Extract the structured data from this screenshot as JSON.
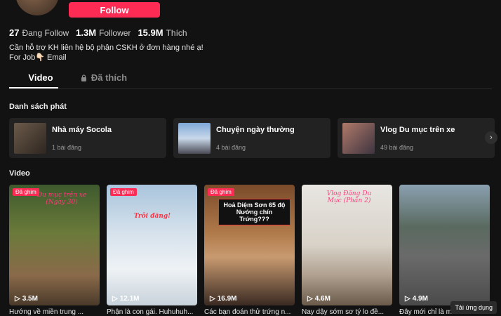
{
  "profile": {
    "follow_label": "Follow",
    "stats": [
      {
        "value": "27",
        "label": "Đang Follow"
      },
      {
        "value": "1.3M",
        "label": "Follower"
      },
      {
        "value": "15.9M",
        "label": "Thích"
      }
    ],
    "bio_line1": "Cần hỗ trợ KH liên hệ bộ phận CSKH ở đơn hàng nhé ạ!",
    "bio_line2": "For Job👇🏻 Email"
  },
  "tabs": [
    {
      "label": "Video"
    },
    {
      "label": "Đã thích",
      "icon": "lock-icon"
    }
  ],
  "playlists_title": "Danh sách phát",
  "playlists": [
    {
      "name": "Nhà máy Socola",
      "count": "1 bài đăng"
    },
    {
      "name": "Chuyện ngày thường",
      "count": "4 bài đăng"
    },
    {
      "name": "Vlog Du mục trên xe",
      "count": "49 bài đăng"
    }
  ],
  "videos_title": "Video",
  "videos": [
    {
      "badge": "Đã ghim",
      "views": "3.5M",
      "caption": "Hướng về miền trung ...",
      "overlay": "Du mục trên xe (Ngày 30)"
    },
    {
      "badge": "Đã ghim",
      "views": "12.1M",
      "caption": "Phận là con gái. Huhuhuh...",
      "overlay": "Trôi đăng!"
    },
    {
      "badge": "Đã ghim",
      "views": "16.9M",
      "caption": "Các bạn đoán thử trứng n...",
      "overlay": "Hoả Diệm Sơn 65 độ Nướng chín Trứng???"
    },
    {
      "views": "4.6M",
      "caption": "Nay dậy sớm sơ tý lo đề...",
      "overlay": "Vlog Đăng Du Mục (Phần 2)"
    },
    {
      "views": "4.9M",
      "caption": "Đây mới chỉ là m...",
      "overlay": ""
    }
  ],
  "app_button": "Tải ứng dụng"
}
